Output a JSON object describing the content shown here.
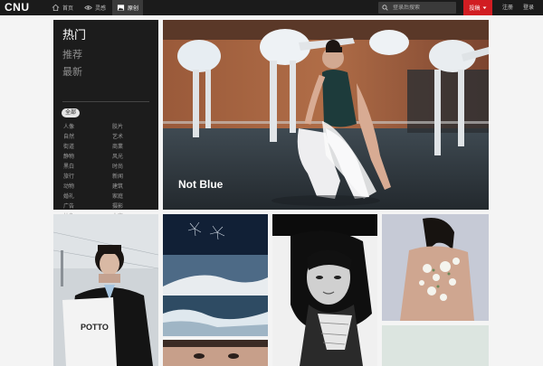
{
  "header": {
    "logo": "CNU",
    "nav": [
      {
        "label": "首页",
        "icon": "home-icon"
      },
      {
        "label": "灵感",
        "icon": "eye-icon"
      },
      {
        "label": "原创",
        "icon": "image-icon",
        "active": true
      }
    ],
    "search_placeholder": "登录后搜索",
    "post_label": "投稿",
    "register_label": "注册",
    "login_label": "登录"
  },
  "categories": {
    "tabs": [
      "热门",
      "推荐",
      "最新"
    ],
    "all_label": "全部",
    "left_column": [
      "人像",
      "自然",
      "街道",
      "静物",
      "黑白",
      "旅行",
      "动物",
      "婚礼",
      "广告",
      "抽象"
    ],
    "right_column": [
      "胶片",
      "艺术",
      "商業",
      "风光",
      "时尚",
      "新闻",
      "建筑",
      "家庭",
      "摄影",
      "人文"
    ]
  },
  "hero": {
    "title": "Not Blue",
    "slide_count": 4,
    "active_slide": 1
  },
  "colors": {
    "topbar": "#1b1b1b",
    "accent": "#d11d22",
    "panel": "#1c1c1c"
  }
}
